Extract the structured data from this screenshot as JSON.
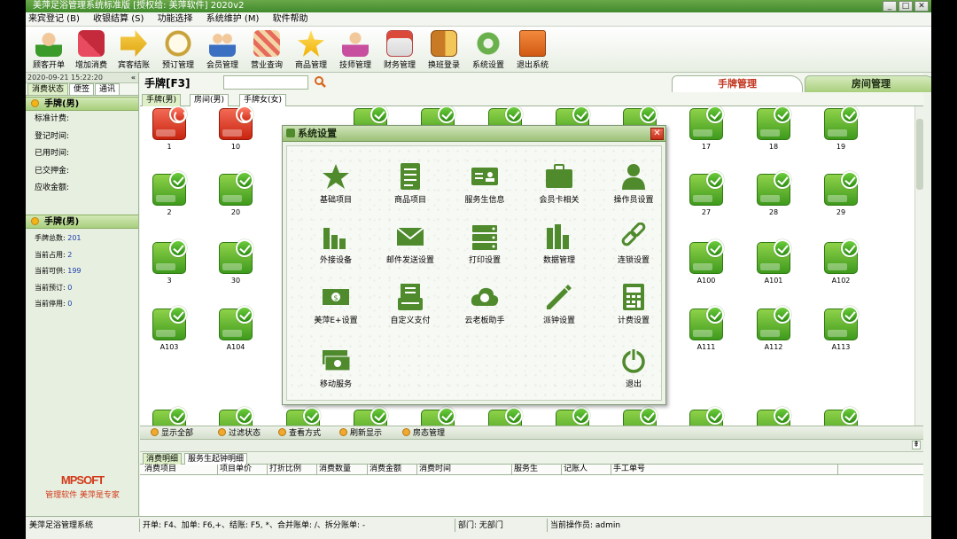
{
  "app": {
    "title": "美萍足浴管理系统标准版 [授权给: 美萍软件]   2020v2",
    "colors": {
      "accent_green": "#4f8a2d",
      "header_green": "#a9cf7d",
      "alert_red": "#c52f18",
      "active_tab_text": "#c0321a"
    }
  },
  "menu": [
    "来宾登记 (B)",
    "收银结算 (S)",
    "功能选择",
    "系统维护 (M)",
    "软件帮助"
  ],
  "toolbar": [
    {
      "label": "顾客开单",
      "icon": "customer-icon"
    },
    {
      "label": "增加消费",
      "icon": "add-consumption-icon"
    },
    {
      "label": "宾客结账",
      "icon": "checkout-icon"
    },
    {
      "label": "预订管理",
      "icon": "clock-icon"
    },
    {
      "label": "会员管理",
      "icon": "members-icon"
    },
    {
      "label": "营业查询",
      "icon": "query-icon"
    },
    {
      "label": "商品管理",
      "icon": "star-icon"
    },
    {
      "label": "技师管理",
      "icon": "technician-icon"
    },
    {
      "label": "财务管理",
      "icon": "finance-icon"
    },
    {
      "label": "换班登录",
      "icon": "shift-icon"
    },
    {
      "label": "系统设置",
      "icon": "gear-icon"
    },
    {
      "label": "退出系统",
      "icon": "exit-icon"
    }
  ],
  "left": {
    "datetime": "2020-09-21 15:22:20",
    "tabs": [
      "消费状态",
      "便签",
      "通讯"
    ],
    "section1": {
      "title": "手牌(男)",
      "rows": [
        "标准计费:",
        "登记时间:",
        "已用时间:",
        "已交押金:",
        "应收金额:"
      ]
    },
    "section2": {
      "title": "手牌(男)",
      "rows": [
        {
          "label": "手牌总数:",
          "value": "201"
        },
        {
          "label": "当前占用:",
          "value": "2"
        },
        {
          "label": "当前可供:",
          "value": "199"
        },
        {
          "label": "当前预订:",
          "value": "0"
        },
        {
          "label": "当前停用:",
          "value": "0"
        }
      ]
    },
    "logo": "MPSOFT",
    "slogan": "管理软件  美萍是专家"
  },
  "main": {
    "search_title": "手牌[F3]",
    "search_value": "",
    "right_tabs": {
      "active": "手牌管理",
      "inactive": "房间管理"
    },
    "sub_tabs": [
      "手牌(男)",
      "房间(男)",
      "手牌女(女)"
    ],
    "rooms": [
      {
        "name": "1",
        "status": "occupied",
        "selected": true
      },
      {
        "name": "10",
        "status": "occupied",
        "selected": true
      },
      {
        "name": "17",
        "status": "free"
      },
      {
        "name": "18",
        "status": "free"
      },
      {
        "name": "19",
        "status": "free"
      },
      {
        "name": "2",
        "status": "free"
      },
      {
        "name": "20",
        "status": "free"
      },
      {
        "name": "27",
        "status": "free"
      },
      {
        "name": "28",
        "status": "free"
      },
      {
        "name": "29",
        "status": "free"
      },
      {
        "name": "3",
        "status": "free"
      },
      {
        "name": "30",
        "status": "free"
      },
      {
        "name": "A100",
        "status": "free"
      },
      {
        "name": "A101",
        "status": "free"
      },
      {
        "name": "A102",
        "status": "free"
      },
      {
        "name": "A103",
        "status": "free"
      },
      {
        "name": "A104",
        "status": "free"
      },
      {
        "name": "A111",
        "status": "free"
      },
      {
        "name": "A112",
        "status": "free"
      },
      {
        "name": "A113",
        "status": "free"
      }
    ],
    "bottom_buttons": [
      "显示全部",
      "过滤状态",
      "查看方式",
      "刷新显示",
      "房态管理"
    ],
    "detail_tabs": [
      "消费明细",
      "服务生起钟明细"
    ],
    "detail_columns": [
      "消费项目",
      "项目单价",
      "打折比例",
      "消费数量",
      "消费金额",
      "消费时间",
      "服务生",
      "记账人",
      "手工单号"
    ]
  },
  "status": {
    "system": "美萍足浴管理系统",
    "shortcuts": "开单: F4、加单: F6,+、结账: F5, *、合并账单: /、拆分账单: -",
    "department": "部门: 无部门",
    "operator": "当前操作员: admin"
  },
  "dialog": {
    "title": "系统设置",
    "items": [
      {
        "label": "基础项目",
        "icon": "star-icon"
      },
      {
        "label": "商品项目",
        "icon": "list-icon"
      },
      {
        "label": "服务生信息",
        "icon": "id-card-icon"
      },
      {
        "label": "会员卡相关",
        "icon": "briefcase-icon"
      },
      {
        "label": "操作员设置",
        "icon": "person-icon"
      },
      {
        "label": "外接设备",
        "icon": "bars-icon"
      },
      {
        "label": "邮件发送设置",
        "icon": "mail-icon"
      },
      {
        "label": "打印设置",
        "icon": "server-icon"
      },
      {
        "label": "数据管理",
        "icon": "data-icon"
      },
      {
        "label": "连锁设置",
        "icon": "link-icon"
      },
      {
        "label": "美萍E+设置",
        "icon": "money-icon"
      },
      {
        "label": "自定义支付",
        "icon": "payment-icon"
      },
      {
        "label": "云老板助手",
        "icon": "cloud-icon"
      },
      {
        "label": "派钟设置",
        "icon": "pen-icon"
      },
      {
        "label": "计费设置",
        "icon": "calculator-icon"
      },
      {
        "label": "移动服务",
        "icon": "mobile-money-icon"
      },
      {
        "label": "退出",
        "icon": "power-icon"
      }
    ]
  }
}
